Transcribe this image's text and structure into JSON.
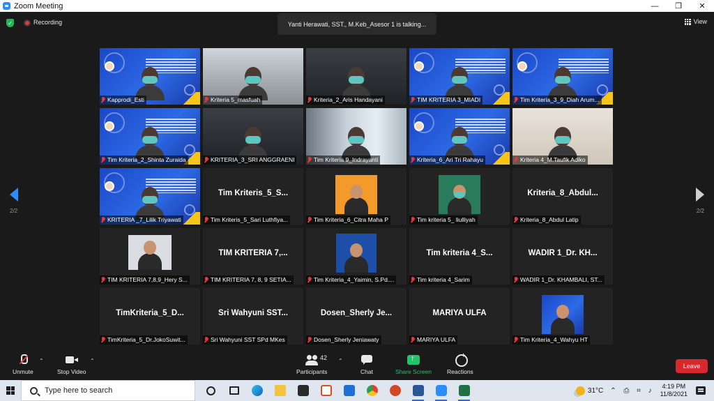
{
  "window": {
    "title": "Zoom Meeting",
    "controls": [
      "—",
      "❐",
      "✕"
    ]
  },
  "topbar": {
    "recording_label": "Recording",
    "talking_text": "Yanti Herawati, SST., M.Keb_Asesor 1 is talking...",
    "view_label": "View"
  },
  "pagination": {
    "left": "2/2",
    "right": "2/2"
  },
  "participants": [
    {
      "name": "Kapprodi_Esti",
      "kind": "slide"
    },
    {
      "name": "Kriteria 5_masfuah",
      "kind": "cam-light"
    },
    {
      "name": "Kriteria_2_Aris Handayani",
      "kind": "cam-dark"
    },
    {
      "name": "TIM KRITERIA 3_MIADI",
      "kind": "slide"
    },
    {
      "name": "Tim Kriteria_3_9_Diah Arum...",
      "kind": "slide"
    },
    {
      "name": "Tim Kriteria_2_Shinta Zuraida",
      "kind": "slide"
    },
    {
      "name": "KRITERIA_3_SRI ANGGRAENI",
      "kind": "cam-dark"
    },
    {
      "name": "Tim Kriteria 9_Indrayanti",
      "kind": "cam-window"
    },
    {
      "name": "Kriteria_6_Ari Tri Rahayu",
      "kind": "slide"
    },
    {
      "name": "Kriteria 4_M.Taufik Adiko",
      "kind": "cam-room"
    },
    {
      "name": "KRITERIA _7_Lilik Triyawati",
      "kind": "slide"
    },
    {
      "name": "Tim Kriteris_5_Sari Luthfiya...",
      "kind": "name",
      "display": "Tim  Kriteris_5_S..."
    },
    {
      "name": "Tim Kriteria_6_Citra Maha P",
      "kind": "photo-orange"
    },
    {
      "name": "Tim kriteria 5_ liulliyah",
      "kind": "photo-green"
    },
    {
      "name": "Kriteria_8_Abdul Latip",
      "kind": "name",
      "display": "Kriteria_8_Abdul..."
    },
    {
      "name": "TIM KRITERIA 7,8,9_Hery S...",
      "kind": "photo-office"
    },
    {
      "name": "TIM KRITERIA 7, 8, 9 SETIA...",
      "kind": "name",
      "display": "TIM KRITERIA 7,..."
    },
    {
      "name": "Tim Kriteria_4_Yaimin, S.Pd....",
      "kind": "photo-blue"
    },
    {
      "name": "Tim kriteria 4_Sarim",
      "kind": "name",
      "display": "Tim  kriteria  4_S..."
    },
    {
      "name": "WADIR 1_Dr. KHAMBALI, ST...",
      "kind": "name",
      "display": "WADIR 1_Dr. KH..."
    },
    {
      "name": "TimKriteria_5_Dr.JokoSuwit...",
      "kind": "name",
      "display": "TimKriteria_5_D..."
    },
    {
      "name": "Sri Wahyuni SST SPd MKes",
      "kind": "name",
      "display": "Sri  Wahyuni  SST..."
    },
    {
      "name": "Dosen_Sherly Jeniawaty",
      "kind": "name",
      "display": "Dosen_Sherly  Je..."
    },
    {
      "name": "MARIYA ULFA",
      "kind": "name",
      "display": "MARIYA ULFA"
    },
    {
      "name": "Tim Kriteria_4_Wahyu HT",
      "kind": "photo-slide"
    }
  ],
  "toolbar": {
    "unmute": "Unmute",
    "stop_video": "Stop Video",
    "participants": "Participants",
    "participant_count": "42",
    "chat": "Chat",
    "share_screen": "Share Screen",
    "reactions": "Reactions",
    "leave": "Leave"
  },
  "taskbar": {
    "search_placeholder": "Type here to search",
    "temperature": "31°C",
    "time": "4:19 PM",
    "date": "11/8/2021",
    "tray_icons": "⌃ ⎙ ⌗ ♪"
  },
  "colors": {
    "zoom_blue": "#2d8cff",
    "leave_red": "#d9272e",
    "share_green": "#23c26b",
    "muted_red": "#e03a3a"
  }
}
